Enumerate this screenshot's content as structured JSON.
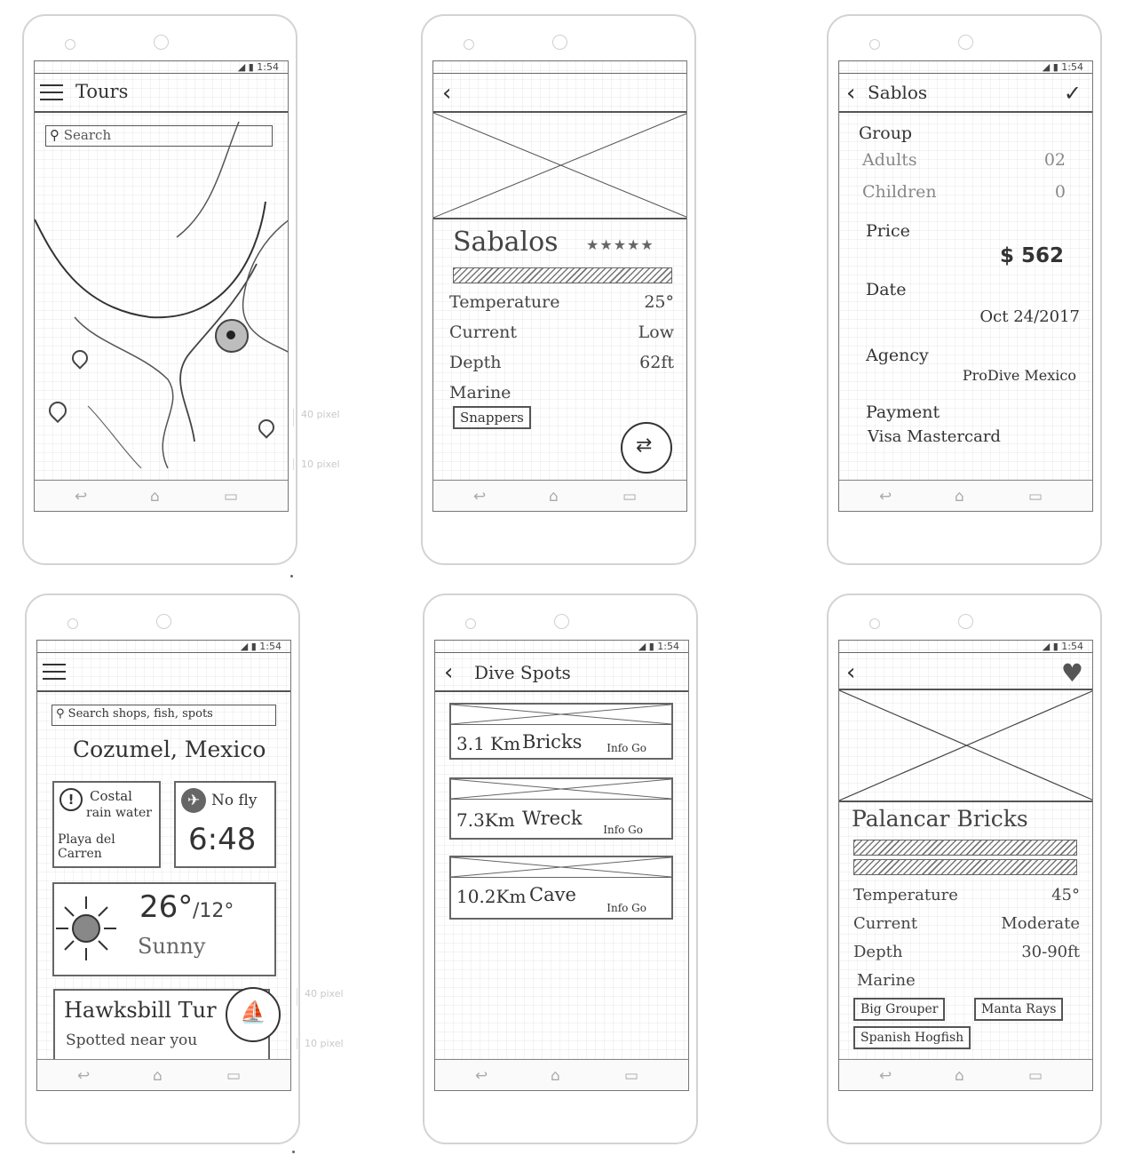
{
  "status": {
    "time": "1:54"
  },
  "measurements": {
    "a": "40 pixel",
    "b": "10 pixel"
  },
  "screen1": {
    "title": "Tours",
    "search_placeholder": "Search"
  },
  "screen2": {
    "name": "Sabalos",
    "stars": "★★★★★",
    "rows": [
      {
        "label": "Temperature",
        "value": "25°"
      },
      {
        "label": "Current",
        "value": "Low"
      },
      {
        "label": "Depth",
        "value": "62ft"
      }
    ],
    "marine_label": "Marine",
    "chip": "Snappers"
  },
  "screen3": {
    "title": "Sablos",
    "group_label": "Group",
    "adults_label": "Adults",
    "adults_value": "02",
    "children_label": "Children",
    "children_value": "0",
    "price_label": "Price",
    "price_value": "$ 562",
    "date_label": "Date",
    "date_value": "Oct 24/2017",
    "agency_label": "Agency",
    "agency_value": "ProDive Mexico",
    "payment_label": "Payment",
    "payment_value": "Visa Mastercard"
  },
  "screen4": {
    "search_placeholder": "Search shops, fish, spots",
    "location": "Cozumel, Mexico",
    "alert_line1": "Costal",
    "alert_line2": "rain water",
    "alert_line3": "Playa del Carren",
    "nofly_label": "No fly",
    "nofly_time": "6:48",
    "temp_hi": "26°",
    "temp_lo": "/12°",
    "condition": "Sunny",
    "sighting_title": "Hawksbill Tur",
    "sighting_sub": "Spotted near you"
  },
  "screen5": {
    "title": "Dive Spots",
    "spots": [
      {
        "dist": "3.1 Km",
        "name": "Bricks",
        "actions": "Info Go"
      },
      {
        "dist": "7.3Km",
        "name": "Wreck",
        "actions": "Info Go"
      },
      {
        "dist": "10.2Km",
        "name": "Cave",
        "actions": "Info Go"
      }
    ]
  },
  "screen6": {
    "name": "Palancar Bricks",
    "rows": [
      {
        "label": "Temperature",
        "value": "45°"
      },
      {
        "label": "Current",
        "value": "Moderate"
      },
      {
        "label": "Depth",
        "value": "30-90ft"
      }
    ],
    "marine_label": "Marine",
    "chips": [
      "Big Grouper",
      "Manta Rays",
      "Spanish Hogfish"
    ]
  }
}
